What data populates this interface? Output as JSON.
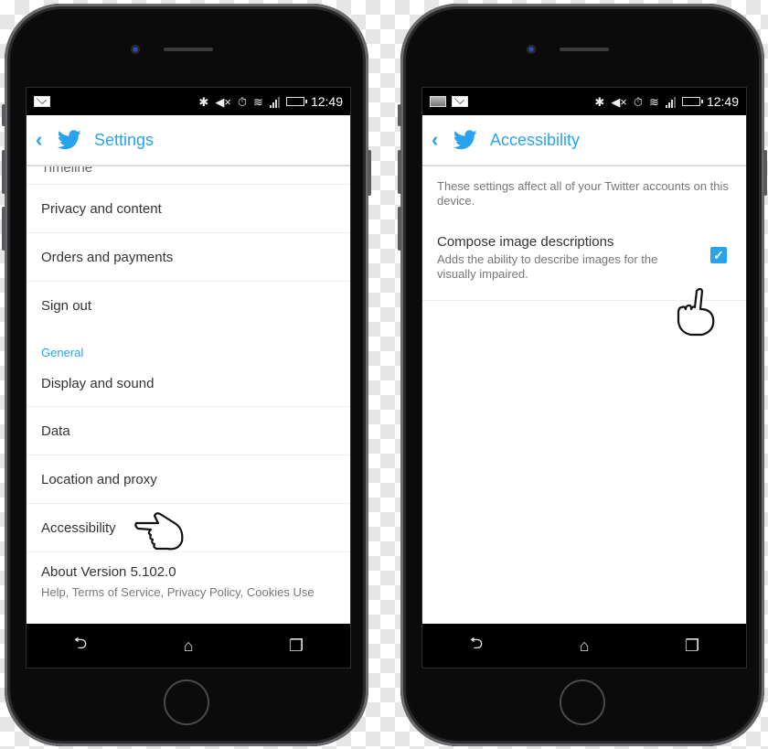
{
  "colors": {
    "accent": "#2aa3ef",
    "status_bar": "#000000"
  },
  "status_bar": {
    "time": "12:49"
  },
  "left_screen": {
    "app_bar": {
      "back_icon": "chevron-left-icon",
      "logo": "twitter-bird-icon",
      "title": "Settings"
    },
    "partial_item": "Timeline",
    "items_top": [
      {
        "label": "Privacy and content"
      },
      {
        "label": "Orders and payments"
      },
      {
        "label": "Sign out"
      }
    ],
    "section_general": "General",
    "items_general": [
      {
        "label": "Display and sound"
      },
      {
        "label": "Data"
      },
      {
        "label": "Location and proxy"
      },
      {
        "label": "Accessibility"
      }
    ],
    "about": {
      "title": "About Version 5.102.0",
      "subtitle": "Help, Terms of Service, Privacy Policy, Cookies Use"
    },
    "pointer": "pointing-hand-icon"
  },
  "right_screen": {
    "app_bar": {
      "back_icon": "chevron-left-icon",
      "logo": "twitter-bird-icon",
      "title": "Accessibility"
    },
    "info": "These settings affect all of your Twitter accounts on this device.",
    "preference": {
      "title": "Compose image descriptions",
      "subtitle": "Adds the ability to describe images for the visually impaired.",
      "checked": true
    },
    "pointer": "tapping-hand-icon"
  },
  "nav_bar": {
    "back": "back-icon",
    "home": "home-icon",
    "recents": "recents-icon"
  },
  "glyphs": {
    "bluetooth": "✱",
    "mute": "🔇",
    "alarm": "⏰",
    "check": "✓",
    "back": "⮌",
    "home": "⌂",
    "recents": "❐",
    "chevron": "‹"
  }
}
